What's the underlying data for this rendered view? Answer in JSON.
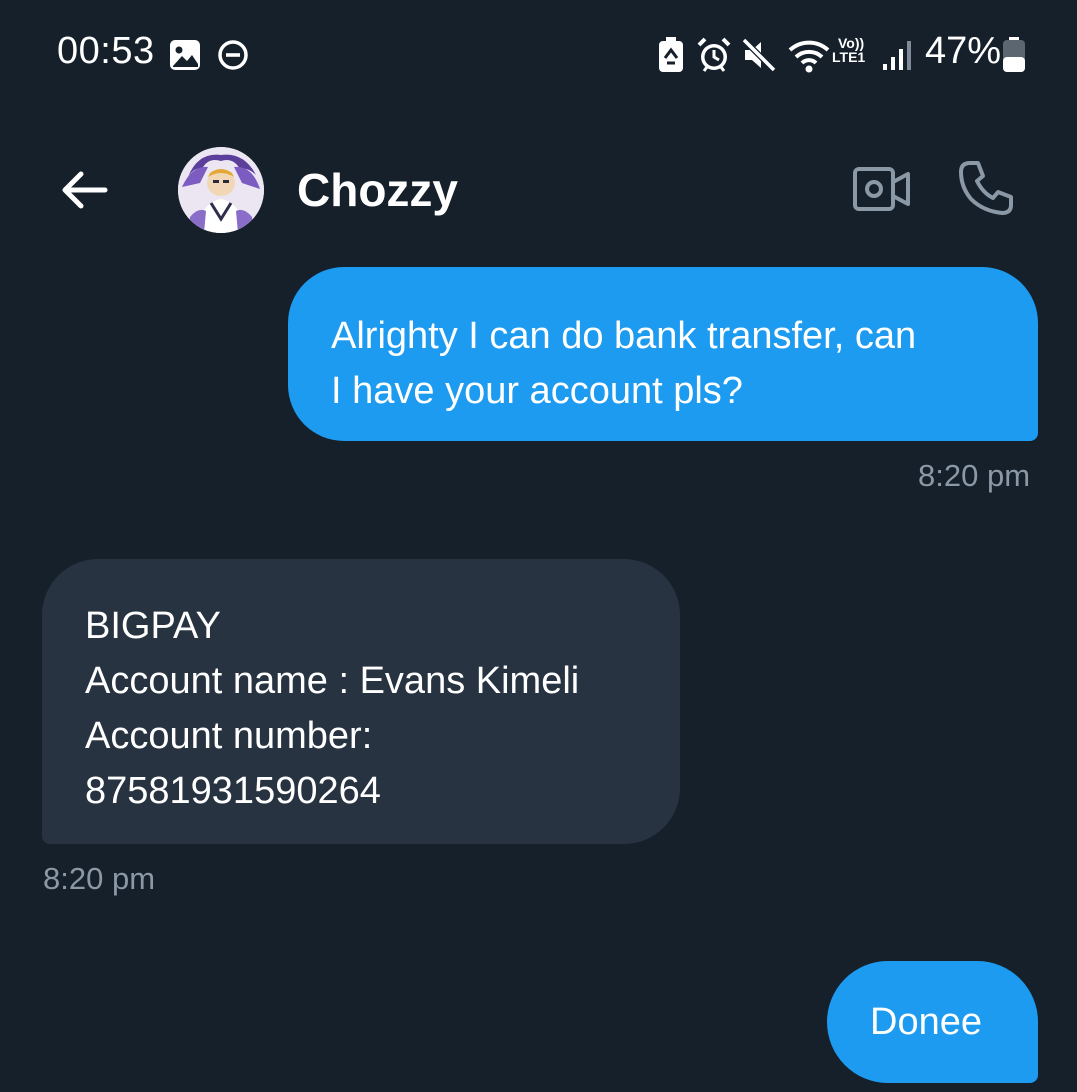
{
  "status_bar": {
    "time": "00:53",
    "network_label": "Vo))",
    "lte_label": "LTE1",
    "battery_percent": "47%",
    "battery_level": 0.47,
    "icons": [
      "gallery-icon",
      "do-not-disturb-icon",
      "battery-saver-icon",
      "alarm-icon",
      "mute-icon",
      "wifi-icon",
      "signal-icon",
      "battery-icon"
    ]
  },
  "header": {
    "back_icon": "arrow-left-icon",
    "contact_name": "Chozzy",
    "video_icon": "video-camera-icon",
    "call_icon": "phone-icon"
  },
  "messages": [
    {
      "direction": "outgoing",
      "lines": [
        "Alrighty I can do bank transfer, can",
        "I have your account pls?"
      ],
      "time": "8:20 pm"
    },
    {
      "direction": "incoming",
      "lines": [
        "BIGPAY",
        "Account name : Evans Kimeli",
        "Account number:",
        "87581931590264"
      ],
      "time": "8:20 pm"
    },
    {
      "direction": "outgoing",
      "lines": [
        "Donee"
      ]
    }
  ],
  "colors": {
    "background": "#15202b",
    "outgoing_bubble": "#1d9bf0",
    "incoming_bubble": "#273340",
    "timestamp": "#8b98a5"
  }
}
